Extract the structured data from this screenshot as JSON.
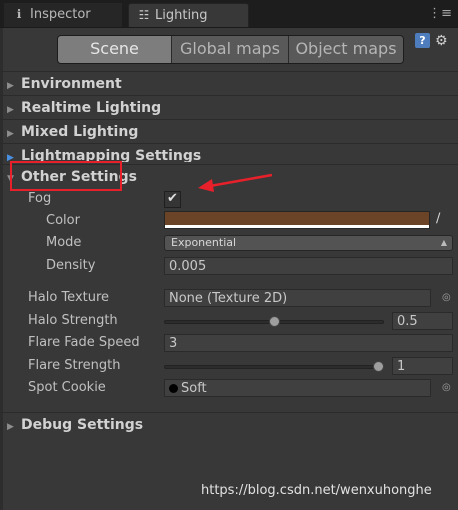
{
  "tabs": {
    "inspector_label": "Inspector",
    "inspector_icon": "info-icon",
    "lighting_label": "Lighting",
    "lighting_icon": "sliders-icon",
    "menu_icon": "tab-menu-icon"
  },
  "scopes": {
    "items": [
      "Scene",
      "Global maps",
      "Object maps"
    ],
    "selected": "Scene"
  },
  "header_icons": {
    "help": "?",
    "settings": "gear-icon"
  },
  "sections": {
    "environment": "Environment",
    "realtime_lighting": "Realtime Lighting",
    "mixed_lighting": "Mixed Lighting",
    "lightmapping_settings": "Lightmapping Settings",
    "other_settings": "Other Settings",
    "debug_settings": "Debug Settings"
  },
  "fog": {
    "label": "Fog",
    "enabled": true,
    "color_label": "Color",
    "color_value": "#6b4428",
    "mode_label": "Mode",
    "mode_value": "Exponential",
    "density_label": "Density",
    "density_value": "0.005"
  },
  "halo": {
    "texture_label": "Halo Texture",
    "texture_value": "None (Texture 2D)",
    "strength_label": "Halo Strength",
    "strength_value": "0.5",
    "strength_fraction": 0.5
  },
  "flare": {
    "fade_speed_label": "Flare Fade Speed",
    "fade_speed_value": "3",
    "strength_label": "Flare Strength",
    "strength_value": "1",
    "strength_fraction": 1.0
  },
  "spot_cookie": {
    "label": "Spot Cookie",
    "value": "Soft"
  },
  "annotation": {
    "highlight_color": "#e8202a"
  },
  "watermark": "https://blog.csdn.net/wenxuhonghe"
}
